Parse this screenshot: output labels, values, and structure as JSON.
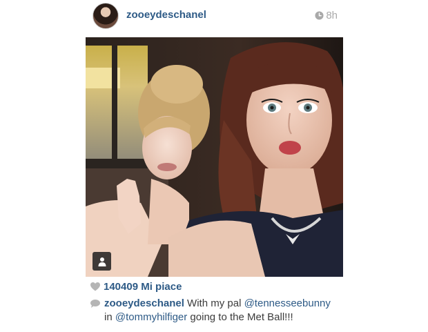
{
  "post": {
    "username": "zooeydeschanel",
    "time": "8h",
    "likes": "140409 Mi piace",
    "caption": {
      "username": "zooeydeschanel",
      "text_1": " With my pal ",
      "mention_1": "@tennesseebunny",
      "text_2": " in ",
      "mention_2": "@tommyhilfiger",
      "text_3": " going to the Met Ball!!!"
    }
  },
  "icons": {
    "clock": "clock-icon",
    "heart": "heart-icon",
    "comment": "comment-bubble-icon",
    "tag": "person-tag-icon"
  },
  "colors": {
    "link_blue": "#2d5a86",
    "muted_gray": "#a9a9a9"
  }
}
